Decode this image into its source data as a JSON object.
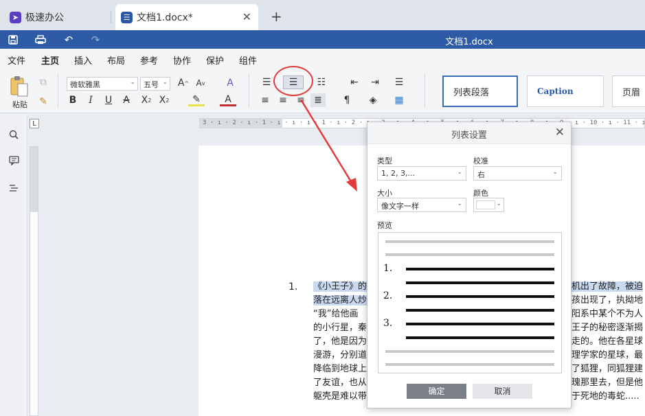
{
  "tabs": {
    "app": {
      "label": "极速办公"
    },
    "doc": {
      "label": "文档1.docx*"
    }
  },
  "quickbar": {
    "title": "文档1.docx"
  },
  "menu": [
    "文件",
    "主页",
    "插入",
    "布局",
    "参考",
    "协作",
    "保护",
    "组件"
  ],
  "ribbon": {
    "paste_label": "粘贴",
    "font_name": "微软雅黑",
    "font_size": "五号",
    "styles": [
      "列表段落",
      "Caption",
      "页眉"
    ]
  },
  "ruler": {
    "ticks": "3 · ı · 2 · ı · 1 · ı · ı · ı · 1 · ı · 2 · ı · 3 · ı · 4 · ı · 5 · ı · 6 · ı · 7 · ı · 8 · ı · 9 · ı · 10 · ı · 11 · ı · 12 · ı · 13 · ı ·"
  },
  "document": {
    "list_number": "1.",
    "left_lines": [
      "《小王子》的",
      "落在远离人炒",
      "“我”给他画",
      "的小行星，秦",
      "了，他是因为",
      "漫游，分别道",
      "降临到地球上",
      "了友谊，也从",
      "躯壳是难以带"
    ],
    "right_lines": [
      "机出了故障，被迫",
      "孩出现了，执拗地",
      "阳系中某个不为人",
      "王子的秘密逐渐揭",
      "走的。他在各星球",
      "理学家的星球，最",
      "了狐狸，同狐狸建",
      "瑰那里去，但是他",
      "于死地的毒蛇....."
    ]
  },
  "dialog": {
    "title": "列表设置",
    "type_label": "类型",
    "type_value": "1, 2, 3,...",
    "align_label": "校准",
    "align_value": "右",
    "size_label": "大小",
    "size_value": "像文字一样",
    "color_label": "颜色",
    "color_value": "#ffffff",
    "preview_label": "预览",
    "preview_numbers": [
      "1.",
      "2.",
      "3."
    ],
    "ok_label": "确定",
    "cancel_label": "取消"
  },
  "colors": {
    "accent": "#2d5ba6",
    "annotation": "#e33b3b"
  }
}
